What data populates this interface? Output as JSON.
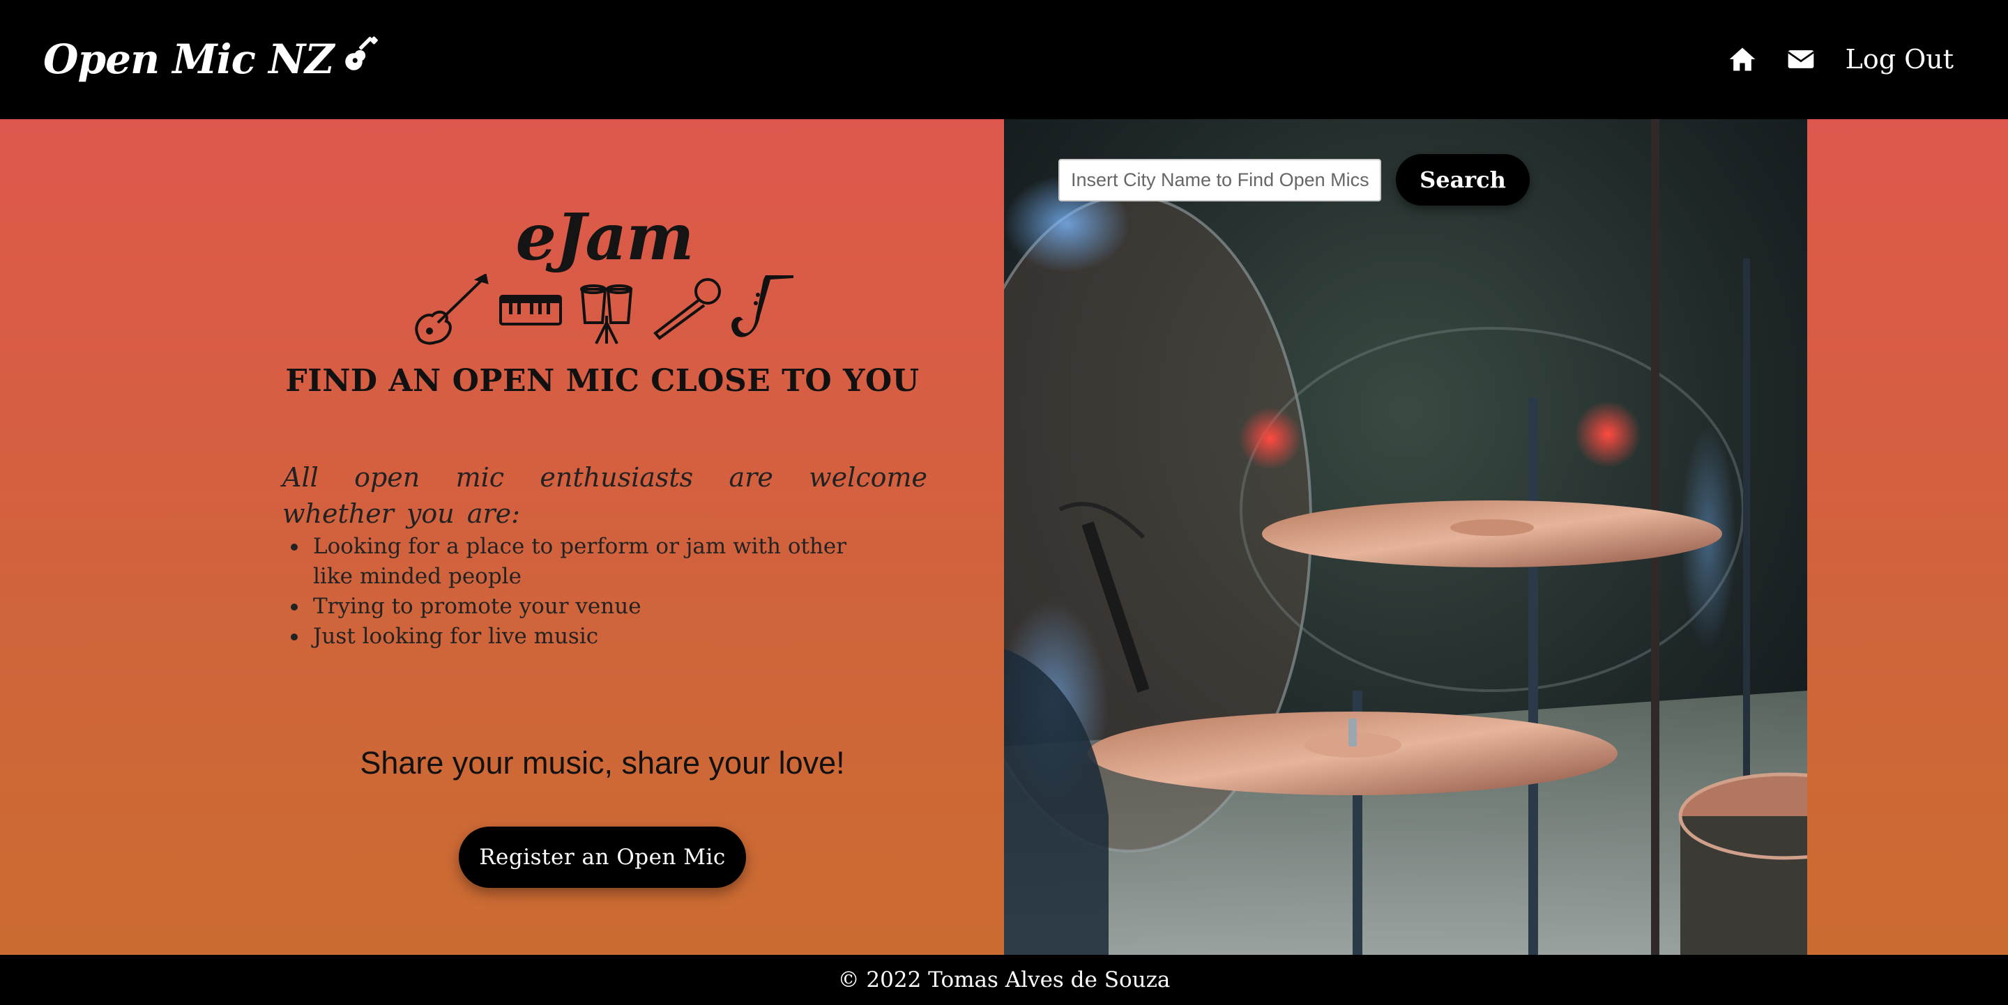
{
  "header": {
    "brand": "Open Mic NZ",
    "brand_icon": "guitar-icon",
    "nav": {
      "home_icon": "home-icon",
      "mail_icon": "envelope-icon",
      "logout_label": "Log Out"
    }
  },
  "hero": {
    "app_name": "eJam",
    "instrument_icons": [
      "electric-guitar-icon",
      "keyboard-icon",
      "conga-drums-icon",
      "microphone-icon",
      "saxophone-icon"
    ],
    "headline": "FIND AN OPEN MIC CLOSE TO YOU",
    "welcome": "All open mic enthusiasts are welcome whether you are:",
    "reasons": [
      "Looking for a place to perform or jam with other like minded people",
      "Trying to promote your venue",
      "Just looking for live music"
    ],
    "tagline": "Share your music, share your love!",
    "register_label": "Register an Open Mic"
  },
  "search": {
    "placeholder": "Insert City Name to Find Open Mics",
    "value": "",
    "button_label": "Search"
  },
  "footer": {
    "copyright": "© 2022 Tomas Alves de Souza"
  },
  "colors": {
    "header_bg": "#000000",
    "gradient_top": "#de574c",
    "gradient_bottom": "#cb6c32",
    "button_bg": "#000000"
  }
}
